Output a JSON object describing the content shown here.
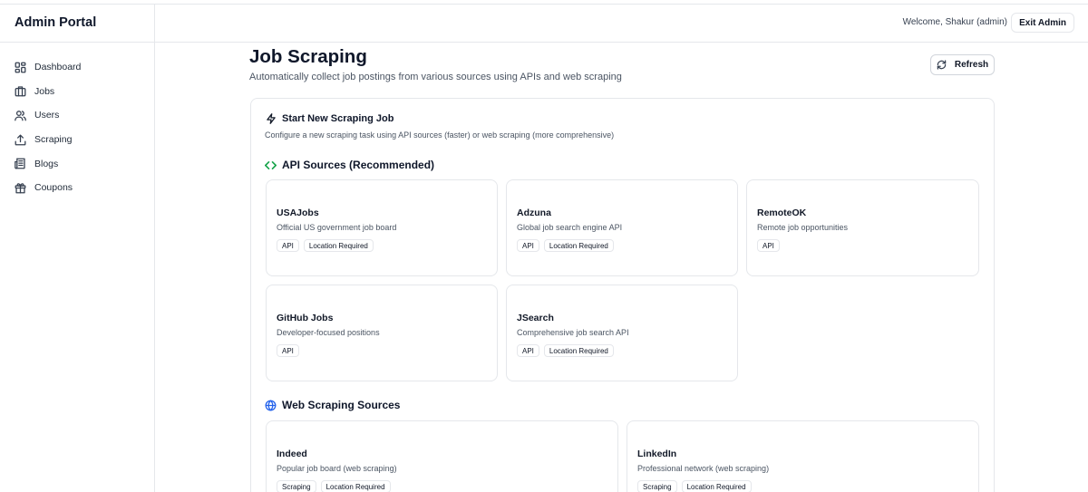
{
  "sidebar": {
    "brand": "Admin Portal",
    "items": [
      {
        "label": "Dashboard",
        "icon": "dashboard-icon"
      },
      {
        "label": "Jobs",
        "icon": "briefcase-icon"
      },
      {
        "label": "Users",
        "icon": "users-icon"
      },
      {
        "label": "Scraping",
        "icon": "upload-icon"
      },
      {
        "label": "Blogs",
        "icon": "newspaper-icon"
      },
      {
        "label": "Coupons",
        "icon": "gift-icon"
      }
    ]
  },
  "header": {
    "welcome": "Welcome, Shakur (admin)",
    "exit_label": "Exit Admin"
  },
  "main": {
    "title": "Job Scraping",
    "subtitle": "Automatically collect job postings from various sources using APIs and web scraping",
    "refresh_label": "Refresh",
    "refresh_icon": "refresh-icon"
  },
  "new_job": {
    "title": "Start New Scraping Job",
    "subtitle": "Configure a new scraping task using API sources (faster) or web scraping (more comprehensive)",
    "icon": "zap-icon"
  },
  "api_sources": {
    "title": "API Sources (Recommended)",
    "icon": "code-icon",
    "icon_color": "#16a34a",
    "cards": [
      {
        "name": "USAJobs",
        "desc": "Official US government job board",
        "tags": [
          "API",
          "Location Required"
        ]
      },
      {
        "name": "Adzuna",
        "desc": "Global job search engine API",
        "tags": [
          "API",
          "Location Required"
        ]
      },
      {
        "name": "RemoteOK",
        "desc": "Remote job opportunities",
        "tags": [
          "API"
        ]
      },
      {
        "name": "GitHub Jobs",
        "desc": "Developer-focused positions",
        "tags": [
          "API"
        ]
      },
      {
        "name": "JSearch",
        "desc": "Comprehensive job search API",
        "tags": [
          "API",
          "Location Required"
        ]
      }
    ]
  },
  "web_sources": {
    "title": "Web Scraping Sources",
    "icon": "globe-icon",
    "icon_color": "#2563eb",
    "cards": [
      {
        "name": "Indeed",
        "desc": "Popular job board (web scraping)",
        "tags": [
          "Scraping",
          "Location Required"
        ]
      },
      {
        "name": "LinkedIn",
        "desc": "Professional network (web scraping)",
        "tags": [
          "Scraping",
          "Location Required"
        ]
      }
    ]
  }
}
